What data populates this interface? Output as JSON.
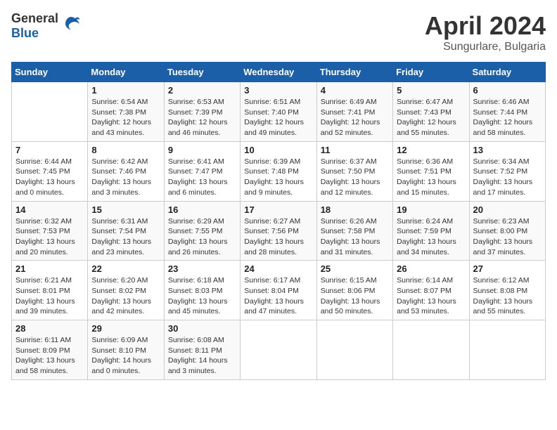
{
  "header": {
    "logo": {
      "general": "General",
      "blue": "Blue",
      "bird": "▶"
    },
    "title": "April 2024",
    "subtitle": "Sungurlare, Bulgaria"
  },
  "weekdays": [
    "Sunday",
    "Monday",
    "Tuesday",
    "Wednesday",
    "Thursday",
    "Friday",
    "Saturday"
  ],
  "weeks": [
    [
      {
        "day": "",
        "info": ""
      },
      {
        "day": "1",
        "info": "Sunrise: 6:54 AM\nSunset: 7:38 PM\nDaylight: 12 hours\nand 43 minutes."
      },
      {
        "day": "2",
        "info": "Sunrise: 6:53 AM\nSunset: 7:39 PM\nDaylight: 12 hours\nand 46 minutes."
      },
      {
        "day": "3",
        "info": "Sunrise: 6:51 AM\nSunset: 7:40 PM\nDaylight: 12 hours\nand 49 minutes."
      },
      {
        "day": "4",
        "info": "Sunrise: 6:49 AM\nSunset: 7:41 PM\nDaylight: 12 hours\nand 52 minutes."
      },
      {
        "day": "5",
        "info": "Sunrise: 6:47 AM\nSunset: 7:43 PM\nDaylight: 12 hours\nand 55 minutes."
      },
      {
        "day": "6",
        "info": "Sunrise: 6:46 AM\nSunset: 7:44 PM\nDaylight: 12 hours\nand 58 minutes."
      }
    ],
    [
      {
        "day": "7",
        "info": "Sunrise: 6:44 AM\nSunset: 7:45 PM\nDaylight: 13 hours\nand 0 minutes."
      },
      {
        "day": "8",
        "info": "Sunrise: 6:42 AM\nSunset: 7:46 PM\nDaylight: 13 hours\nand 3 minutes."
      },
      {
        "day": "9",
        "info": "Sunrise: 6:41 AM\nSunset: 7:47 PM\nDaylight: 13 hours\nand 6 minutes."
      },
      {
        "day": "10",
        "info": "Sunrise: 6:39 AM\nSunset: 7:48 PM\nDaylight: 13 hours\nand 9 minutes."
      },
      {
        "day": "11",
        "info": "Sunrise: 6:37 AM\nSunset: 7:50 PM\nDaylight: 13 hours\nand 12 minutes."
      },
      {
        "day": "12",
        "info": "Sunrise: 6:36 AM\nSunset: 7:51 PM\nDaylight: 13 hours\nand 15 minutes."
      },
      {
        "day": "13",
        "info": "Sunrise: 6:34 AM\nSunset: 7:52 PM\nDaylight: 13 hours\nand 17 minutes."
      }
    ],
    [
      {
        "day": "14",
        "info": "Sunrise: 6:32 AM\nSunset: 7:53 PM\nDaylight: 13 hours\nand 20 minutes."
      },
      {
        "day": "15",
        "info": "Sunrise: 6:31 AM\nSunset: 7:54 PM\nDaylight: 13 hours\nand 23 minutes."
      },
      {
        "day": "16",
        "info": "Sunrise: 6:29 AM\nSunset: 7:55 PM\nDaylight: 13 hours\nand 26 minutes."
      },
      {
        "day": "17",
        "info": "Sunrise: 6:27 AM\nSunset: 7:56 PM\nDaylight: 13 hours\nand 28 minutes."
      },
      {
        "day": "18",
        "info": "Sunrise: 6:26 AM\nSunset: 7:58 PM\nDaylight: 13 hours\nand 31 minutes."
      },
      {
        "day": "19",
        "info": "Sunrise: 6:24 AM\nSunset: 7:59 PM\nDaylight: 13 hours\nand 34 minutes."
      },
      {
        "day": "20",
        "info": "Sunrise: 6:23 AM\nSunset: 8:00 PM\nDaylight: 13 hours\nand 37 minutes."
      }
    ],
    [
      {
        "day": "21",
        "info": "Sunrise: 6:21 AM\nSunset: 8:01 PM\nDaylight: 13 hours\nand 39 minutes."
      },
      {
        "day": "22",
        "info": "Sunrise: 6:20 AM\nSunset: 8:02 PM\nDaylight: 13 hours\nand 42 minutes."
      },
      {
        "day": "23",
        "info": "Sunrise: 6:18 AM\nSunset: 8:03 PM\nDaylight: 13 hours\nand 45 minutes."
      },
      {
        "day": "24",
        "info": "Sunrise: 6:17 AM\nSunset: 8:04 PM\nDaylight: 13 hours\nand 47 minutes."
      },
      {
        "day": "25",
        "info": "Sunrise: 6:15 AM\nSunset: 8:06 PM\nDaylight: 13 hours\nand 50 minutes."
      },
      {
        "day": "26",
        "info": "Sunrise: 6:14 AM\nSunset: 8:07 PM\nDaylight: 13 hours\nand 53 minutes."
      },
      {
        "day": "27",
        "info": "Sunrise: 6:12 AM\nSunset: 8:08 PM\nDaylight: 13 hours\nand 55 minutes."
      }
    ],
    [
      {
        "day": "28",
        "info": "Sunrise: 6:11 AM\nSunset: 8:09 PM\nDaylight: 13 hours\nand 58 minutes."
      },
      {
        "day": "29",
        "info": "Sunrise: 6:09 AM\nSunset: 8:10 PM\nDaylight: 14 hours\nand 0 minutes."
      },
      {
        "day": "30",
        "info": "Sunrise: 6:08 AM\nSunset: 8:11 PM\nDaylight: 14 hours\nand 3 minutes."
      },
      {
        "day": "",
        "info": ""
      },
      {
        "day": "",
        "info": ""
      },
      {
        "day": "",
        "info": ""
      },
      {
        "day": "",
        "info": ""
      }
    ]
  ]
}
